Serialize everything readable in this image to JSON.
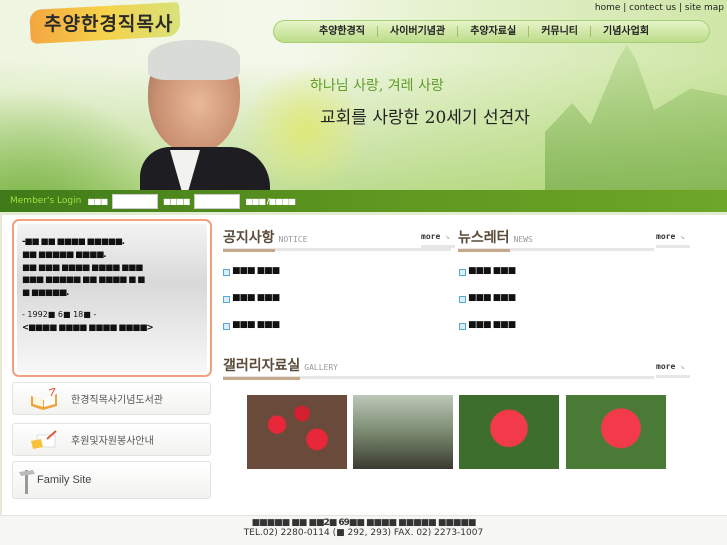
{
  "header": {
    "logo": "추양한경직목사",
    "top_links": [
      "home",
      "contect us",
      "site map"
    ],
    "nav": [
      "추양한경직",
      "사이버기념관",
      "추양자료실",
      "커뮤니티",
      "기념사업회"
    ],
    "slogan_1": "하나님 사랑, 겨레 사랑",
    "slogan_2": "교회를 사랑한 20세기 선견자"
  },
  "login": {
    "title": "Member's Login",
    "id_label": "■■■",
    "pw_label": "■■■■",
    "links": "■■■ /■■■■"
  },
  "quote": {
    "lines": [
      "-■■ ■■ ■■■■ ■■■■■.",
      "■■ ■■■■■ ■■■■.",
      "■■ ■■■ ■■■■ ■■■■ ■■■",
      "■■■ ■■■■■ ■■ ■■■■ ■ ■",
      "■ ■■■■■."
    ],
    "date": "- 1992■ 6■ 18■ -",
    "source": "<■■■■ ■■■■ ■■■■ ■■■■>"
  },
  "left_buttons": [
    "한경직목사기념도서관",
    "후원및자원봉사안내",
    "Family Site"
  ],
  "notice": {
    "title": "공지사항",
    "en": "NOTICE",
    "more": "more",
    "items": [
      "■■■ ■■■",
      "■■■ ■■■",
      "■■■ ■■■"
    ]
  },
  "news": {
    "title": "뉴스레터",
    "en": "NEWS",
    "more": "more",
    "items": [
      "■■■ ■■■",
      "■■■ ■■■",
      "■■■ ■■■"
    ]
  },
  "gallery": {
    "title": "갤러리자료실",
    "en": "GALLERY",
    "more": "more"
  },
  "footer": {
    "address": "■■■■■ ■■ ■■2■ 69■■ ■■■■ ■■■■■ ■■■■■",
    "tel": "TEL.02) 2280-0114 (■ 292, 293) FAX. 02) 2273-1007"
  }
}
